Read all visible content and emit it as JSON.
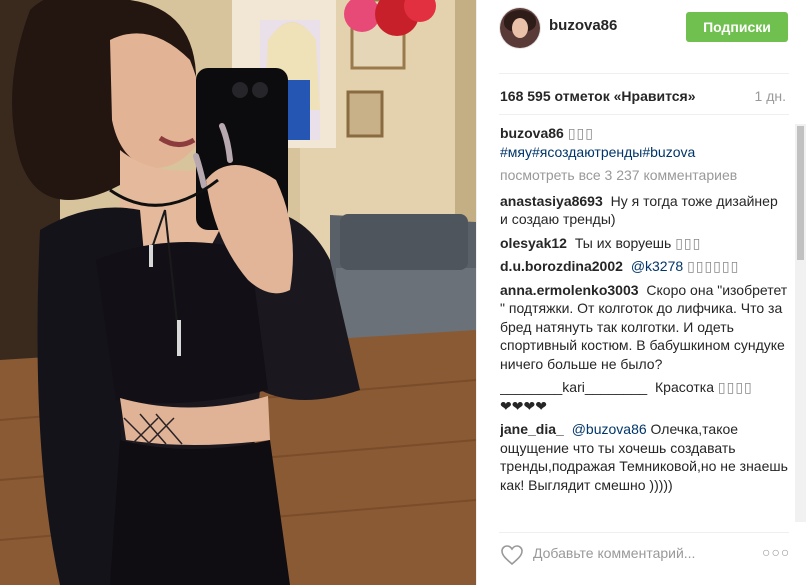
{
  "post": {
    "username": "buzova86",
    "follow_label": "Подписки",
    "likes_text": "168 595 отметок «Нравится»",
    "time_ago": "1 дн.",
    "add_comment_placeholder": "Добавьте комментарий...",
    "more_options": "○○○"
  },
  "caption": {
    "username": "buzova86",
    "emoji": "▯▯▯",
    "hashtags": "#мяу#ясоздаютренды#buzova"
  },
  "view_all_comments": "посмотреть все 3 237 комментариев",
  "comments": [
    {
      "user": "anastasiya8693",
      "text": "Ну я тогда тоже дизайнер и создаю тренды)"
    },
    {
      "user": "olesyak12",
      "text": "Ты их воруешь",
      "emoji": "▯▯▯"
    },
    {
      "user": "d.u.borozdina2002",
      "mention": "@k3278",
      "emoji": "▯▯▯▯▯▯"
    },
    {
      "user": "anna.ermolenko3003",
      "text": "Скоро она \"изобретет \" подтяжки. От колготок до лифчика. Что за бред натянуть так колготки. И одеть спортивный костюм. В бабушкином сундуке ничего больше не было?"
    },
    {
      "user": "________kari________",
      "text": "Красотка",
      "emoji": "▯▯▯▯",
      "hearts": "❤❤❤❤"
    },
    {
      "user": "jane_dia_",
      "mention": "@buzova86",
      "text": "Олечка,такое ощущение что ты хочешь создавать тренды,подражая Темниковой,но не знаешь как! Выглядит смешно )))))"
    }
  ],
  "colors": {
    "follow_button": "#70c050",
    "hashtag": "#003569",
    "muted": "#999999"
  }
}
